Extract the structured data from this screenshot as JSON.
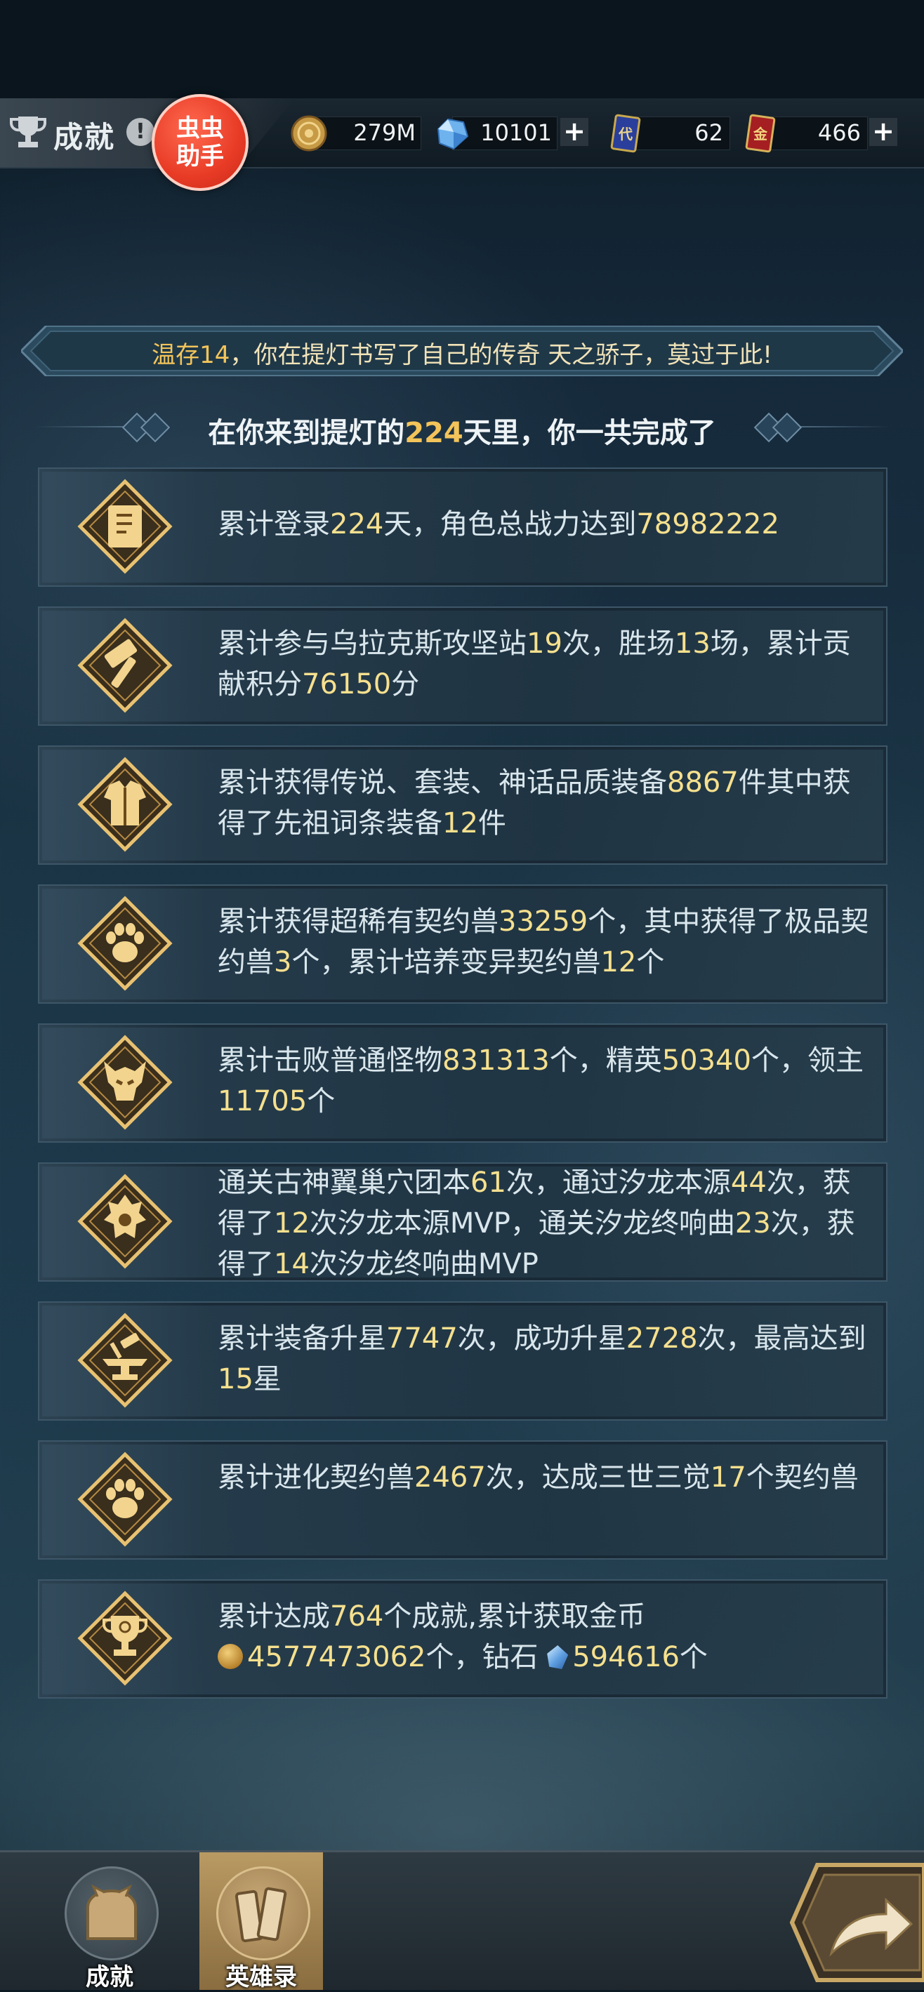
{
  "header": {
    "title": "成就",
    "badge_line1": "虫虫",
    "badge_line2": "助手",
    "resources": [
      {
        "icon": "gold-coin-icon",
        "value": "279M"
      },
      {
        "icon": "diamond-icon",
        "value": "10101"
      },
      {
        "icon": "blue-card-icon",
        "value": "62"
      },
      {
        "icon": "red-card-icon",
        "value": "466"
      }
    ]
  },
  "banner": {
    "prefix": "温存14",
    "text": "，你在提灯书写了自己的传奇 天之骄子，莫过于此!"
  },
  "subhead": {
    "before": "在你来到提灯的",
    "days": "224",
    "after": "天里，你一共完成了"
  },
  "cards": [
    {
      "icon": "scroll-icon",
      "parts": [
        "累计登录",
        "224",
        "天，角色总战力达到",
        "78982222"
      ]
    },
    {
      "icon": "hammer-icon",
      "parts": [
        "累计参与乌拉克斯攻坚站",
        "19",
        "次，胜场",
        "13",
        "场，累计贡献积分",
        "76150",
        "分"
      ]
    },
    {
      "icon": "armor-icon",
      "parts": [
        "累计获得传说、套装、神话品质装备",
        "8867",
        "件其中获得了先祖词条装备",
        "12",
        "件"
      ]
    },
    {
      "icon": "paw-icon",
      "parts": [
        "累计获得超稀有契约兽",
        "33259",
        "个，其中获得了极品契约兽",
        "3",
        "个，累计培养变异契约兽",
        "12",
        "个"
      ]
    },
    {
      "icon": "demon-icon",
      "parts": [
        "累计击败普通怪物",
        "831313",
        "个，精英",
        "50340",
        "个，领主",
        "11705",
        "个"
      ]
    },
    {
      "icon": "dragon-icon",
      "parts": [
        "通关古神翼巢穴团本",
        "61",
        "次，通过汐龙本源",
        "44",
        "次，获得了",
        "12",
        "次汐龙本源MVP，通关汐龙终响曲",
        "23",
        "次，获得了",
        "14",
        "次汐龙终响曲MVP"
      ]
    },
    {
      "icon": "anvil-icon",
      "parts": [
        "累计装备升星",
        "7747",
        "次，成功升星",
        "2728",
        "次，最高达到",
        "15",
        "星"
      ]
    },
    {
      "icon": "paw-icon",
      "parts": [
        "累计进化契约兽",
        "2467",
        "次，达成三世三觉",
        "17",
        "个契约兽"
      ]
    },
    {
      "icon": "trophy-icon",
      "parts": [
        "累计达成",
        "764",
        "个成就,累计获取金币",
        "4577473062",
        "个，钻石",
        "594616",
        "个"
      ]
    }
  ],
  "tabs": [
    {
      "label": "成就",
      "active": false
    },
    {
      "label": "英雄录",
      "active": true
    }
  ],
  "colors": {
    "highlight": "#f6e08e",
    "gold": "#f3c45a",
    "accent_badge": "#e83b26"
  }
}
